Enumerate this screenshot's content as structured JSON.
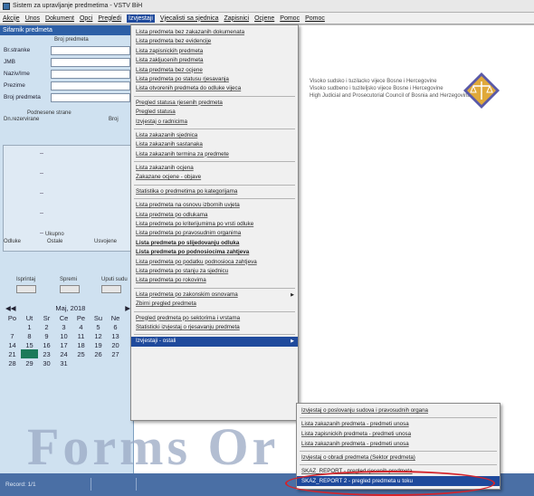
{
  "window": {
    "title": "Sistem za upravljanje predmetima - VSTV BiH"
  },
  "menubar": {
    "items": [
      {
        "label": "Akcije"
      },
      {
        "label": "Unos"
      },
      {
        "label": "Dokument"
      },
      {
        "label": "Opci"
      },
      {
        "label": "Pregledi"
      },
      {
        "label": "Izvjestaji",
        "active": true
      },
      {
        "label": "Vjecalisti sa sjednica"
      },
      {
        "label": "Zapisnici"
      },
      {
        "label": "Ocjene"
      },
      {
        "label": "Pomoc"
      },
      {
        "label": "Pomoc"
      }
    ]
  },
  "left_panel": {
    "title": "Sifarnik predmeta",
    "header_label": "Broj predmeta",
    "fields": [
      "Br.stranke",
      "JMB",
      "Naziv/Ime",
      "Prezime",
      "Broj predmeta"
    ],
    "sub_labels": [
      "Podnesene strane",
      "Broj",
      "Dn.rezervirane"
    ],
    "bottom_labels": [
      "Ukupno",
      "Odluke",
      "Ostale",
      "Usvojene",
      "Odbijene"
    ],
    "button_labels": [
      "Isprintaj",
      "Spremi",
      "Uputi sudu"
    ]
  },
  "calendar": {
    "month_label": "Maj, 2018",
    "days": [
      "Po",
      "Ut",
      "Sr",
      "Ce",
      "Pe",
      "Su",
      "Ne"
    ],
    "weeks": [
      [
        "",
        "1",
        "2",
        "3",
        "4",
        "5",
        "6"
      ],
      [
        "7",
        "8",
        "9",
        "10",
        "11",
        "12",
        "13"
      ],
      [
        "14",
        "15",
        "16",
        "17",
        "18",
        "19",
        "20"
      ],
      [
        "21",
        "22",
        "23",
        "24",
        "25",
        "26",
        "27"
      ],
      [
        "28",
        "29",
        "30",
        "31",
        "",
        "",
        ""
      ]
    ],
    "selected_day": "22"
  },
  "org": {
    "lines": [
      "Visoko sudsko i tuzilacko vijece Bosne i Hercegovine",
      "Visoko sudbeno i tuziteljsko vijece Bosne i Hercegovine",
      "High Judicial and Prosecutorial Council of Bosnia and Herzegovina"
    ]
  },
  "watermark": "Forms Or",
  "status": {
    "text": "Record: 1/1",
    "accent_color": "#4a6fa5"
  },
  "dropdown": {
    "items": [
      {
        "label": "Lista predmeta bez zakazanih dokumenata"
      },
      {
        "label": "Lista predmeta bez evidencije"
      },
      {
        "label": "Lista zapisnickih predmeta"
      },
      {
        "label": "Lista zakljucenih predmeta"
      },
      {
        "label": "Lista predmeta bez ocjene"
      },
      {
        "label": "Lista predmeta po statusu rjesavanja"
      },
      {
        "label": "Lista otvorenih predmeta do odluke vijeca"
      },
      {
        "sep": true
      },
      {
        "label": "Pregled statusa rjesenih predmeta"
      },
      {
        "label": "Pregled statusa"
      },
      {
        "label": "Izvjestaj o radnicima"
      },
      {
        "sep": true
      },
      {
        "label": "Lista zakazanih sjednica"
      },
      {
        "label": "Lista zakazanih sastanaka"
      },
      {
        "label": "Lista zakazanih termina za predmete"
      },
      {
        "sep": true
      },
      {
        "label": "Lista zakazanih ocjena"
      },
      {
        "label": "Zakazane ocjene - objave"
      },
      {
        "sep": true
      },
      {
        "label": "Statistika o predmetima po kategorijama"
      },
      {
        "sep": true
      },
      {
        "label": "Lista predmeta na osnovu izbornih uvjeta"
      },
      {
        "label": "Lista predmeta po odlukama"
      },
      {
        "label": "Lista predmeta po kriterijumima po vrsti odluke"
      },
      {
        "label": "Lista predmeta po pravosudnim organima"
      },
      {
        "label": "Lista predmeta po slijedovanju odluka",
        "bold": true
      },
      {
        "label": "Lista predmeta po podnosiocima zahtjeva",
        "bold": true
      },
      {
        "label": "Lista predmeta po podatku podnosioca zahtjeva"
      },
      {
        "label": "Lista predmeta po stanju za sjednicu"
      },
      {
        "label": "Lista predmeta po rokovima"
      },
      {
        "sep": true
      },
      {
        "label": "Lista predmeta po zakonskim osnovama",
        "arrow": true
      },
      {
        "label": "Zbirni pregled predmeta"
      },
      {
        "sep": true
      },
      {
        "label": "Pregled predmeta po sektorima i vrstama"
      },
      {
        "label": "Statisticki izvjestaj o rjesavanju predmeta"
      },
      {
        "sep": true
      },
      {
        "label": "Izvjestaji - ostali",
        "hl": true
      }
    ]
  },
  "submenu": {
    "items": [
      {
        "label": "Izvjestaj o poslovanju sudova i pravosudnih organa"
      },
      {
        "sep": true
      },
      {
        "label": "Lista zakazanih predmeta - predmeti unosa"
      },
      {
        "label": "Lista zapisnickih predmeta - predmeti unosa"
      },
      {
        "label": "Lista zakazanih predmeta - predmeti unosa"
      },
      {
        "sep": true
      },
      {
        "label": "Izvjestaj o obradi predmeta (Sektor predmeta)"
      },
      {
        "sep": true
      },
      {
        "label": "SKAZ_REPORT - pregled rjesenih predmeta"
      },
      {
        "label": "SKAZ_REPORT 2 - pregled predmeta u toku",
        "hl": true
      }
    ]
  }
}
